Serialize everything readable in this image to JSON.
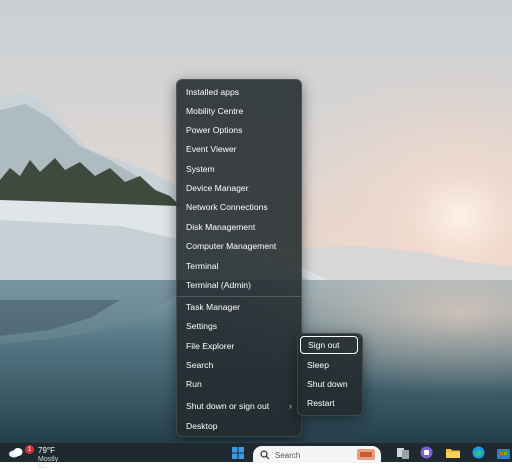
{
  "context_menu": {
    "items": [
      {
        "label": "Installed apps",
        "has_submenu": false
      },
      {
        "label": "Mobility Centre",
        "has_submenu": false
      },
      {
        "label": "Power Options",
        "has_submenu": false
      },
      {
        "label": "Event Viewer",
        "has_submenu": false
      },
      {
        "label": "System",
        "has_submenu": false
      },
      {
        "label": "Device Manager",
        "has_submenu": false
      },
      {
        "label": "Network Connections",
        "has_submenu": false
      },
      {
        "label": "Disk Management",
        "has_submenu": false
      },
      {
        "label": "Computer Management",
        "has_submenu": false
      },
      {
        "label": "Terminal",
        "has_submenu": false
      },
      {
        "label": "Terminal (Admin)",
        "has_submenu": false
      },
      {
        "label": "Task Manager",
        "has_submenu": false
      },
      {
        "label": "Settings",
        "has_submenu": false
      },
      {
        "label": "File Explorer",
        "has_submenu": false
      },
      {
        "label": "Search",
        "has_submenu": false
      },
      {
        "label": "Run",
        "has_submenu": false
      },
      {
        "label": "Shut down or sign out",
        "has_submenu": true
      },
      {
        "label": "Desktop",
        "has_submenu": false
      }
    ]
  },
  "shutdown_submenu": {
    "items": [
      {
        "label": "Sign out",
        "focused": true
      },
      {
        "label": "Sleep",
        "focused": false
      },
      {
        "label": "Shut down",
        "focused": false
      },
      {
        "label": "Restart",
        "focused": false
      }
    ]
  },
  "taskbar": {
    "weather_temp": "79°F",
    "weather_badge": "1",
    "weather_sub": "Mostly cl...",
    "search_label": "Search",
    "icons": [
      "windows-start-icon",
      "task-view-icon",
      "teams-icon",
      "file-explorer-icon",
      "edge-icon",
      "store-icon"
    ]
  },
  "colors": {
    "menu_bg": "#222a2e",
    "accent_start": "#0078d4",
    "badge": "#d13438"
  }
}
